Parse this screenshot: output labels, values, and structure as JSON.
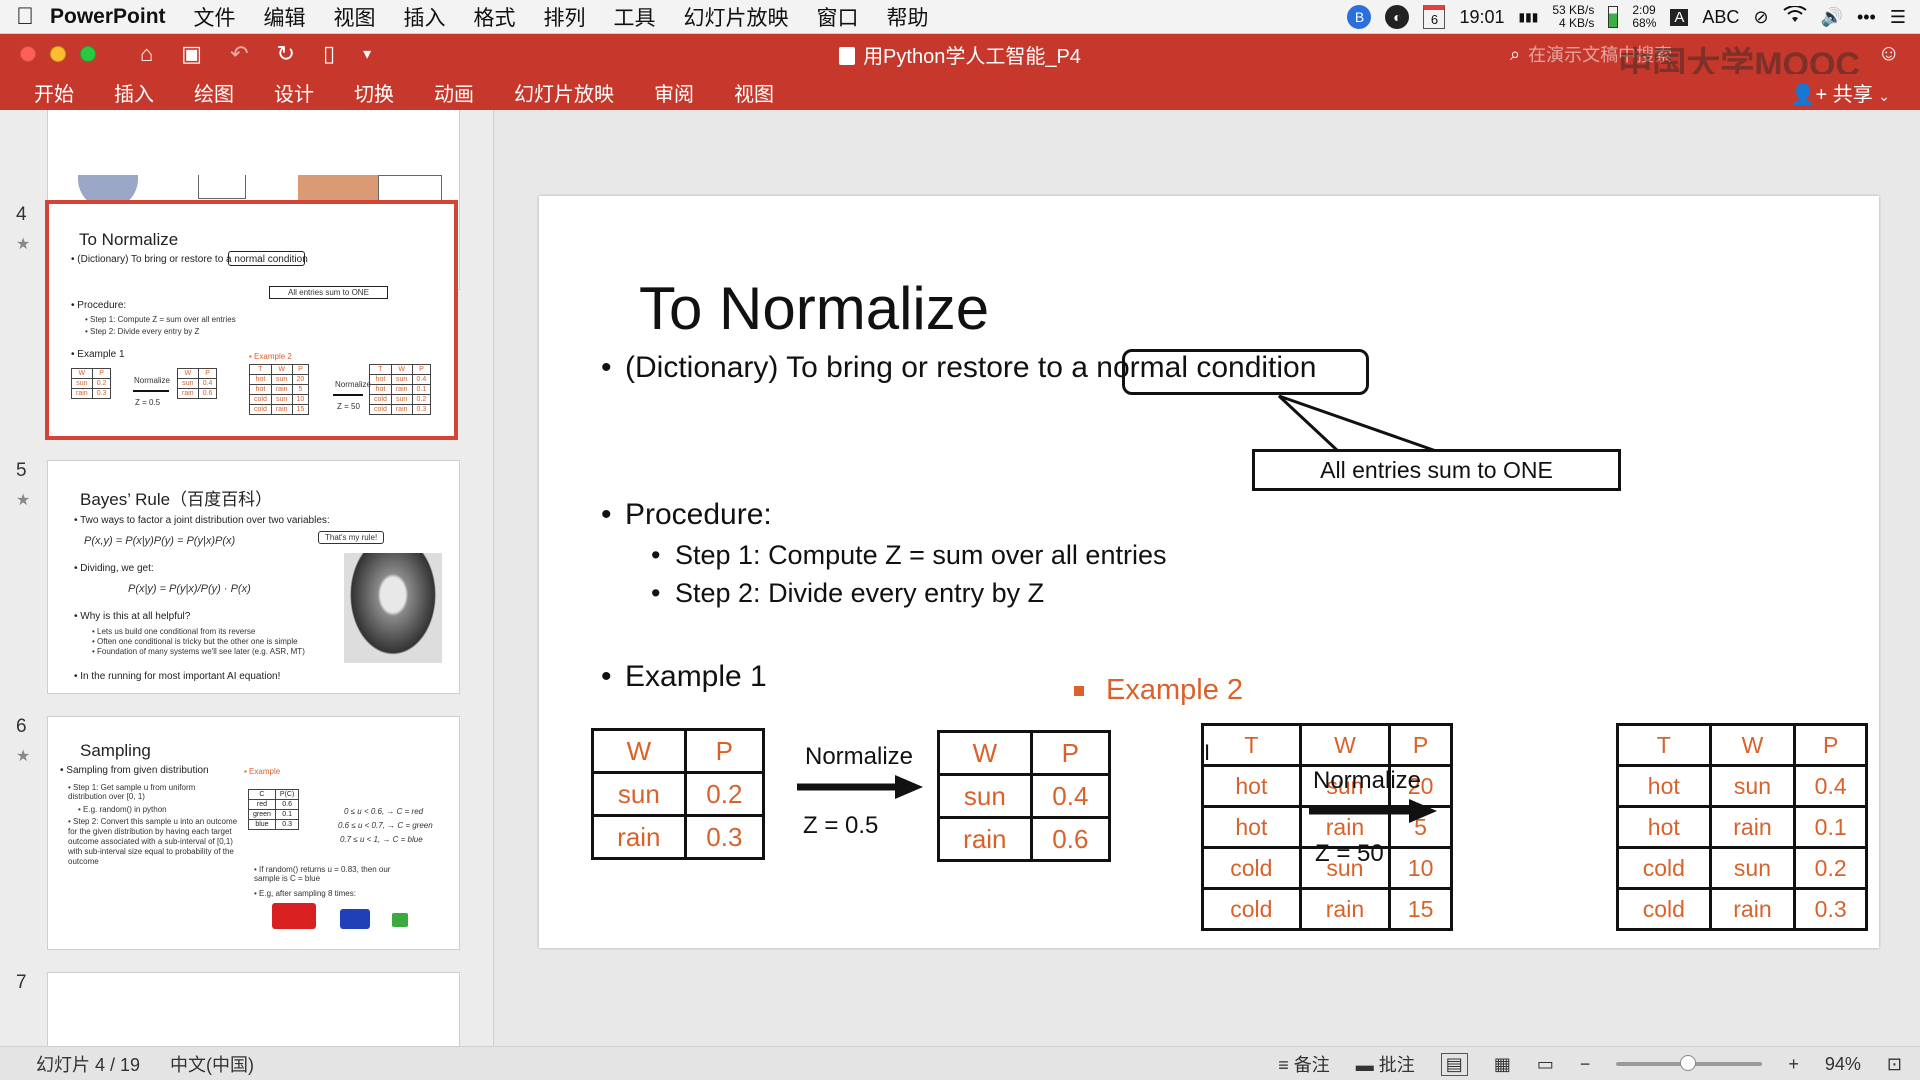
{
  "menubar": {
    "app": "PowerPoint",
    "items": [
      "文件",
      "编辑",
      "视图",
      "插入",
      "格式",
      "排列",
      "工具",
      "幻灯片放映",
      "窗口",
      "帮助"
    ],
    "clock": "19:01",
    "calendar_day": "6",
    "net_up": "53 KB/s",
    "net_down": "4 KB/s",
    "battery_time": "2:09",
    "battery_pct": "68%",
    "input_method": "ABC"
  },
  "window": {
    "title": "用Python学人工智能_P4",
    "search_placeholder": "在演示文稿中搜索",
    "watermark": "中国大学MOOC"
  },
  "ribbon": {
    "tabs": [
      "开始",
      "插入",
      "绘图",
      "设计",
      "切换",
      "动画",
      "幻灯片放映",
      "审阅",
      "视图"
    ],
    "share": "共享"
  },
  "thumbnails": [
    {
      "number": "4",
      "title": "To Normalize",
      "bullet1": "• (Dictionary) To bring or restore to a normal condition",
      "callout": "All entries sum to ONE",
      "procedure": "• Procedure:",
      "step1": "• Step 1: Compute Z = sum over all entries",
      "step2": "• Step 2: Divide every entry by Z",
      "example1": "• Example 1",
      "example2": "▪ Example 2",
      "normalize": "Normalize",
      "z1": "Z = 0.5",
      "z2": "Z = 50"
    },
    {
      "number": "5",
      "title": "Bayes’ Rule（百度百科）",
      "line1": "• Two ways to factor a joint distribution over two variables:",
      "formula1": "P(x,y) = P(x|y)P(y) = P(y|x)P(x)",
      "bubble": "That's my rule!",
      "line2": "• Dividing, we get:",
      "formula2": "P(x|y) = P(y|x)/P(y) · P(x)",
      "line3": "• Why is this at all helpful?",
      "sub1": "• Lets us build one conditional from its reverse",
      "sub2": "• Often one conditional is tricky but the other one is simple",
      "sub3": "• Foundation of many systems we'll see later (e.g. ASR, MT)",
      "line4": "• In the running for most important AI equation!"
    },
    {
      "number": "6",
      "title": "Sampling",
      "line1": "• Sampling from given distribution",
      "example": "▪ Example",
      "step1": "• Step 1: Get sample u from uniform distribution over [0, 1)",
      "step1b": "• E.g. random() in python",
      "step2": "• Step 2: Convert this sample u into an outcome for the given distribution by having each target outcome associated with a sub-interval of [0,1) with sub-interval size equal to probability of the outcome",
      "col_c": "C",
      "col_p": "P(C)",
      "rows": [
        [
          "red",
          "0.6"
        ],
        [
          "green",
          "0.1"
        ],
        [
          "blue",
          "0.3"
        ]
      ],
      "cond1": "0 ≤ u < 0.6, → C = red",
      "cond2": "0.6 ≤ u < 0.7, → C = green",
      "cond3": "0.7 ≤ u < 1, → C = blue",
      "note1": "• If random() returns u = 0.83, then our sample is C = blue",
      "note2": "• E.g, after sampling 8 times:"
    },
    {
      "number": "7"
    }
  ],
  "slide": {
    "title": "To Normalize",
    "bullet1_prefix": "(Dictionary) To bring or restore to ",
    "bullet1_highlight": "a normal condition",
    "callout": "All entries sum to ONE",
    "procedure": "Procedure:",
    "step1": "Step 1: Compute Z = sum over all entries",
    "step2": "Step 2: Divide every entry by Z",
    "example1": "Example 1",
    "example2": "Example 2",
    "normalize_label": "Normalize",
    "z1": "Z = 0.5",
    "z2": "Z = 50",
    "ex1_before": {
      "header": [
        "W",
        "P"
      ],
      "rows": [
        [
          "sun",
          "0.2"
        ],
        [
          "rain",
          "0.3"
        ]
      ]
    },
    "ex1_after": {
      "header": [
        "W",
        "P"
      ],
      "rows": [
        [
          "sun",
          "0.4"
        ],
        [
          "rain",
          "0.6"
        ]
      ]
    },
    "ex2_before": {
      "header": [
        "T",
        "W",
        "P"
      ],
      "rows": [
        [
          "hot",
          "sun",
          "20"
        ],
        [
          "hot",
          "rain",
          "5"
        ],
        [
          "cold",
          "sun",
          "10"
        ],
        [
          "cold",
          "rain",
          "15"
        ]
      ]
    },
    "ex2_after": {
      "header": [
        "T",
        "W",
        "P"
      ],
      "rows": [
        [
          "hot",
          "sun",
          "0.4"
        ],
        [
          "hot",
          "rain",
          "0.1"
        ],
        [
          "cold",
          "sun",
          "0.2"
        ],
        [
          "cold",
          "rain",
          "0.3"
        ]
      ]
    }
  },
  "statusbar": {
    "slide_indicator": "幻灯片 4 / 19",
    "language": "中文(中国)",
    "notes": "备注",
    "comments": "批注",
    "zoom": "94%"
  },
  "colors": {
    "ribbon": "#c5382b",
    "selection": "#d24534",
    "accent": "#d9622b"
  }
}
